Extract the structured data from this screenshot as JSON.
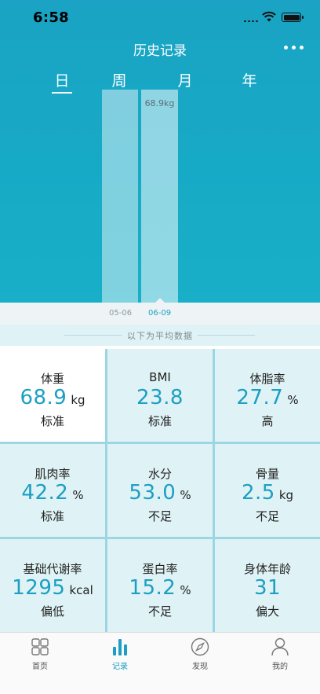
{
  "status_bar": {
    "time": "6:58"
  },
  "header": {
    "title": "历史记录"
  },
  "period_tabs": [
    {
      "label": "日",
      "active": true
    },
    {
      "label": "周",
      "active": false
    },
    {
      "label": "月",
      "active": false
    },
    {
      "label": "年",
      "active": false
    }
  ],
  "chart_data": {
    "type": "bar",
    "categories": [
      "05-06",
      "06-09"
    ],
    "values": [
      null,
      68.9
    ],
    "data_labels": [
      "",
      "68.9kg"
    ],
    "selected_index": 1
  },
  "average_banner": "以下为平均数据",
  "metrics": [
    {
      "name": "体重",
      "value": "68.9",
      "unit": "kg",
      "status": "标准"
    },
    {
      "name": "BMI",
      "value": "23.8",
      "unit": "",
      "status": "标准"
    },
    {
      "name": "体脂率",
      "value": "27.7",
      "unit": "%",
      "status": "高"
    },
    {
      "name": "肌肉率",
      "value": "42.2",
      "unit": "%",
      "status": "标准"
    },
    {
      "name": "水分",
      "value": "53.0",
      "unit": "%",
      "status": "不足"
    },
    {
      "name": "骨量",
      "value": "2.5",
      "unit": "kg",
      "status": "不足"
    },
    {
      "name": "基础代谢率",
      "value": "1295",
      "unit": "kcal",
      "status": "偏低"
    },
    {
      "name": "蛋白率",
      "value": "15.2",
      "unit": "%",
      "status": "不足"
    },
    {
      "name": "身体年龄",
      "value": "31",
      "unit": "",
      "status": "偏大"
    }
  ],
  "tabbar": [
    {
      "label": "首页",
      "icon": "grid-icon",
      "active": false
    },
    {
      "label": "记录",
      "icon": "bar-chart-icon",
      "active": true
    },
    {
      "label": "发现",
      "icon": "compass-icon",
      "active": false
    },
    {
      "label": "我的",
      "icon": "person-icon",
      "active": false
    }
  ],
  "colors": {
    "accent": "#1b9fc2",
    "header_bg": "#17aac6",
    "cell_bg": "#dff2f5"
  }
}
